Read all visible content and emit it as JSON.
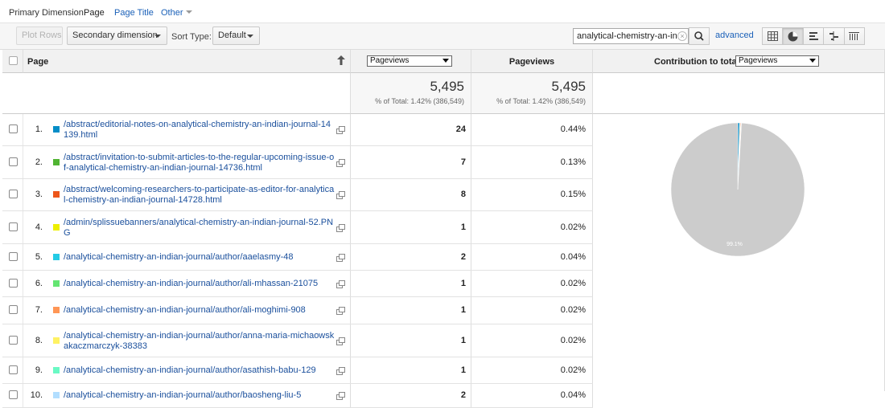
{
  "primary_dimension": {
    "label": "Primary Dimension:",
    "options": [
      "Page",
      "Page Title",
      "Other"
    ]
  },
  "toolbar": {
    "plot_rows": "Plot Rows",
    "secondary_dimension": "Secondary dimension",
    "sort_type_label": "Sort Type:",
    "sort_type_value": "Default",
    "search_value": "analytical-chemistry-an-in",
    "advanced": "advanced",
    "view_icons": [
      "table-view-icon",
      "pie-view-icon",
      "performance-view-icon",
      "comparison-view-icon",
      "term-cloud-icon"
    ],
    "active_view": "pie-view-icon"
  },
  "table": {
    "header": {
      "page": "Page",
      "metric_select": "Pageviews",
      "pageviews": "Pageviews",
      "contribution_label": "Contribution to total:",
      "contribution_select": "Pageviews"
    },
    "totals": {
      "pageviews": "5,495",
      "pageviews_sub": "% of Total: 1.42% (386,549)",
      "pageviews2": "5,495",
      "pageviews2_sub": "% of Total: 1.42% (386,549)"
    },
    "rows": [
      {
        "num": "1.",
        "color": "#058dc7",
        "page": "/abstract/editorial-notes-on-analytical-chemistry-an-indian-journal-14139.html",
        "pageviews": "24",
        "pct": "0.44%"
      },
      {
        "num": "2.",
        "color": "#50b432",
        "page": "/abstract/invitation-to-submit-articles-to-the-regular-upcoming-issue-of-analytical-chemistry-an-indian-journal-14736.html",
        "pageviews": "7",
        "pct": "0.13%"
      },
      {
        "num": "3.",
        "color": "#ed561b",
        "page": "/abstract/welcoming-researchers-to-participate-as-editor-for-analytical-chemistry-an-indian-journal-14728.html",
        "pageviews": "8",
        "pct": "0.15%"
      },
      {
        "num": "4.",
        "color": "#edef00",
        "page": "/admin/splissuebanners/analytical-chemistry-an-indian-journal-52.PNG",
        "pageviews": "1",
        "pct": "0.02%"
      },
      {
        "num": "5.",
        "color": "#24cbe5",
        "page": "/analytical-chemistry-an-indian-journal/author/aaelasmy-48",
        "pageviews": "2",
        "pct": "0.04%"
      },
      {
        "num": "6.",
        "color": "#64e572",
        "page": "/analytical-chemistry-an-indian-journal/author/ali-mhassan-21075",
        "pageviews": "1",
        "pct": "0.02%"
      },
      {
        "num": "7.",
        "color": "#ff9655",
        "page": "/analytical-chemistry-an-indian-journal/author/ali-moghimi-908",
        "pageviews": "1",
        "pct": "0.02%"
      },
      {
        "num": "8.",
        "color": "#fff263",
        "page": "/analytical-chemistry-an-indian-journal/author/anna-maria-michaowskakaczmarczyk-38383",
        "pageviews": "1",
        "pct": "0.02%"
      },
      {
        "num": "9.",
        "color": "#6af9c4",
        "page": "/analytical-chemistry-an-indian-journal/author/asathish-babu-129",
        "pageviews": "1",
        "pct": "0.02%"
      },
      {
        "num": "10.",
        "color": "#b2deff",
        "page": "/analytical-chemistry-an-indian-journal/author/baosheng-liu-5",
        "pageviews": "2",
        "pct": "0.04%"
      }
    ]
  },
  "pie": {
    "label": "99.1%",
    "other_color": "#cccccc",
    "slices": [
      0.44,
      0.13,
      0.15,
      0.02,
      0.04,
      0.02,
      0.02,
      0.02,
      0.02,
      0.04
    ]
  }
}
